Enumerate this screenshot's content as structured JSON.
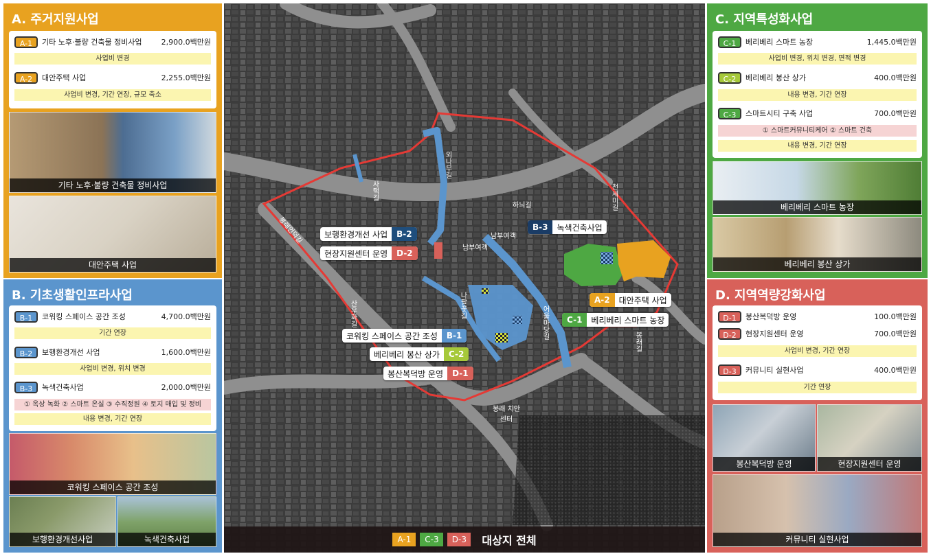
{
  "colors": {
    "orange": "#e8a220",
    "blue": "#5b95cd",
    "green": "#4ea843",
    "red": "#d8615a",
    "note_yellow": "#fbf5b0",
    "note_pink": "#f6d4d4",
    "boundary": "#e53a35"
  },
  "panelA": {
    "title": "A. 주거지원사업",
    "items": [
      {
        "code": "A-1",
        "name": "기타 노후·불량 건축물 정비사업",
        "amount": "2,900.0백만원",
        "note": "사업비 변경"
      },
      {
        "code": "A-2",
        "name": "대안주택 사업",
        "amount": "2,255.0백만원",
        "note": "사업비 변경, 기간 연장, 규모 축소"
      }
    ],
    "photos": [
      "기타 노후·불량 건축물 정비사업",
      "대안주택 사업"
    ]
  },
  "panelB": {
    "title": "B. 기초생활인프라사업",
    "items": [
      {
        "code": "B-1",
        "name": "코워킹 스페이스 공간 조성",
        "amount": "4,700.0백만원",
        "note": "기간 연장"
      },
      {
        "code": "B-2",
        "name": "보행환경개선 사업",
        "amount": "1,600.0백만원",
        "note": "사업비 변경, 위치 변경"
      },
      {
        "code": "B-3",
        "name": "녹색건축사업",
        "amount": "2,000.0백만원",
        "subnote": "① 옥상 녹화 ② 스마트 온실 ③ 수직정원 ④ 토지 매입 및 정비",
        "note": "내용 변경, 기간 연장"
      }
    ],
    "photos": [
      "코워킹 스페이스 공간 조성",
      "보행환경개선사업",
      "녹색건축사업"
    ]
  },
  "panelC": {
    "title": "C. 지역특성화사업",
    "items": [
      {
        "code": "C-1",
        "name": "베리베리 스마트 농장",
        "amount": "1,445.0백만원",
        "note": "사업비 변경, 위치 변경, 면적 변경"
      },
      {
        "code": "C-2",
        "name": "베리베리 봉산 상가",
        "amount": "400.0백만원",
        "note": "내용 변경, 기간 연장"
      },
      {
        "code": "C-3",
        "name": "스마트시티 구축 사업",
        "amount": "700.0백만원",
        "subnote": "① 스마트커뮤니티케어 ② 스마트 건축",
        "note": "내용 변경, 기간 연장"
      }
    ],
    "photos": [
      "베리베리 스마트 농장",
      "베리베리 봉산 상가"
    ]
  },
  "panelD": {
    "title": "D. 지역역량강화사업",
    "items": [
      {
        "code": "D-1",
        "name": "봉산복덕방 운영",
        "amount": "100.0백만원"
      },
      {
        "code": "D-2",
        "name": "현장지원센터 운영",
        "amount": "700.0백만원",
        "note": "사업비 변경, 기간 연장"
      },
      {
        "code": "D-3",
        "name": "커뮤니티 실현사업",
        "amount": "400.0백만원",
        "note": "기간 연장"
      }
    ],
    "photos": [
      "봉산복덕방 운영",
      "현장지원센터 운영",
      "커뮤니티 실현사업"
    ]
  },
  "map": {
    "labels": {
      "b2": {
        "text": "보행환경개선 사업",
        "code": "B-2"
      },
      "d2": {
        "text": "현장지원센터 운영",
        "code": "D-2"
      },
      "b3": {
        "text": "녹색건축사업",
        "code": "B-3"
      },
      "a2": {
        "text": "대안주택 사업",
        "code": "A-2"
      },
      "c1": {
        "text": "베리베리 스마트 농장",
        "code": "C-1"
      },
      "b1": {
        "text": "코워킹 스페이스 공간 조성",
        "code": "B-1"
      },
      "c2": {
        "text": "베리베리 봉산 상가",
        "code": "C-2"
      },
      "d1": {
        "text": "봉산복덕방 운영",
        "code": "D-1"
      }
    },
    "streets": [
      "사택길",
      "외나무길",
      "하늬길",
      "천세미길",
      "봉래언덕길",
      "산우화길",
      "나팔꽃길",
      "어울마당길",
      "봉래길",
      "남부여객",
      "남부여객",
      "봉래 치안센터"
    ],
    "legend": {
      "codes": [
        "A-1",
        "C-3",
        "D-3"
      ],
      "label": "대상지 전체"
    }
  }
}
